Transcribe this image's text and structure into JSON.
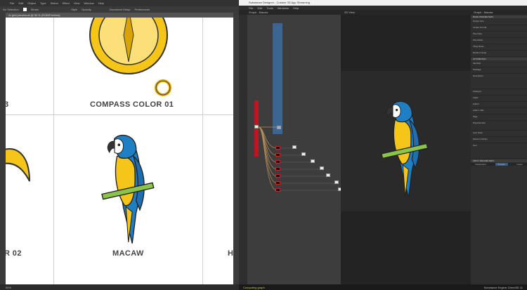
{
  "illustrator": {
    "menu": [
      "File",
      "Edit",
      "Object",
      "Type",
      "Select",
      "Effect",
      "View",
      "Window",
      "Help"
    ],
    "control": {
      "selection": "No Selection",
      "stroke_label": "Stroke",
      "opacity_label": "Opacity",
      "style_label": "Style",
      "doc_setup": "Document Setup",
      "preferences": "Preferences"
    },
    "doc_tab": "AI grid preview.ai @ 50 % (RGB/Preview)",
    "artboards": [
      "COMPASS COLOR 01",
      "MACAW"
    ],
    "partial_labels": [
      "3",
      "R 02",
      "H"
    ],
    "status": {
      "zoom": "50%"
    }
  },
  "designer": {
    "title": "Substance Designer - Custom 3D App Streaming",
    "menu": [
      "File",
      "Edit",
      "Tools",
      "Windows",
      "Help"
    ],
    "graph_panel": "Graph - Macaw",
    "view_panel": "2D View",
    "props_panel": "Graph - Macaw",
    "sections": {
      "base": "BASE PARAMETERS",
      "attributes": "ATTRIBUTES",
      "input": "INPUT PARAMETERS"
    },
    "props": [
      "Output Size",
      "Output Format",
      "Pixel Size",
      "Pixel Ratio",
      "Tiling Mode",
      "Random Seed",
      "Identifier",
      "Package",
      "Description",
      "Category",
      "Label",
      "Author",
      "Author URL",
      "Tags",
      "Physical Size",
      "User Data",
      "Show In Library",
      "Icon"
    ],
    "input_tabs": [
      "Parameters",
      "Presets",
      "Inputs"
    ],
    "status_left": "Computing graph",
    "status_right": "Substance Engine: Direct3D 11"
  },
  "colors": {
    "yellow": "#f5c518",
    "blue": "#1f7fc4",
    "green": "#8ac44a",
    "node_red": "#c0161b",
    "frame_blue": "#3c6591"
  }
}
